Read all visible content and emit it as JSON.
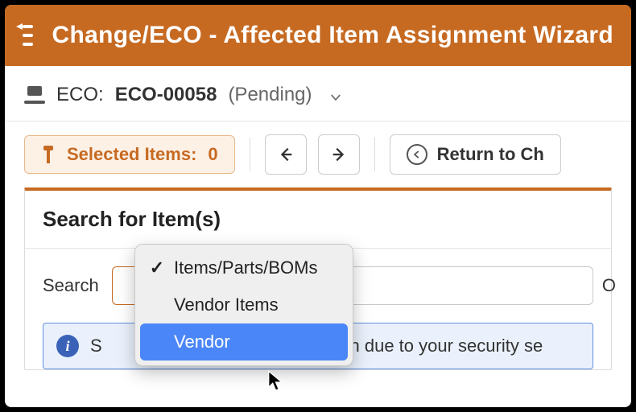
{
  "header": {
    "title": "Change/ECO - Affected Item Assignment Wizard"
  },
  "eco": {
    "label": "ECO:",
    "id": "ECO-00058",
    "status": "(Pending)"
  },
  "toolbar": {
    "selected_label": "Selected Items:",
    "selected_count": "0",
    "return_label": "Return to Ch"
  },
  "panel": {
    "title": "Search for Item(s)",
    "search_label": "Search",
    "info_prefix": "S",
    "info_rest": "hidden due to your security se",
    "rhs_char": "O"
  },
  "dropdown": {
    "items": [
      {
        "label": "Items/Parts/BOMs",
        "checked": true,
        "highlight": false
      },
      {
        "label": "Vendor Items",
        "checked": false,
        "highlight": false
      },
      {
        "label": "Vendor",
        "checked": false,
        "highlight": true
      }
    ]
  }
}
